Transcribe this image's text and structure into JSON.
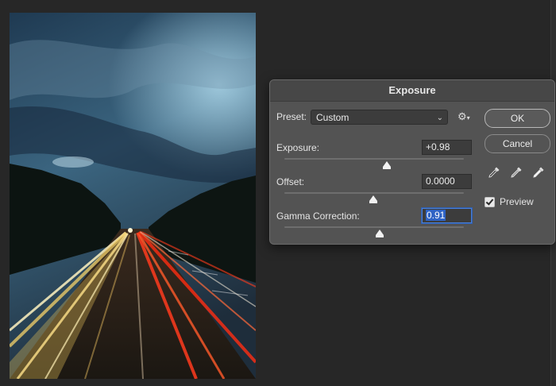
{
  "dialog": {
    "title": "Exposure",
    "preset_label": "Preset:",
    "preset_value": "Custom",
    "exposure_label": "Exposure:",
    "exposure_value": "+0.98",
    "offset_label": "Offset:",
    "offset_value": "0.0000",
    "gamma_label": "Gamma Correction:",
    "gamma_value": "0.91",
    "ok_label": "OK",
    "cancel_label": "Cancel",
    "preview_label": "Preview",
    "preview_checked": true
  },
  "icons": {
    "preset_menu": "chevron-down-icon",
    "settings": "gear-icon",
    "droppers": [
      "black-point-eyedropper-icon",
      "gray-point-eyedropper-icon",
      "white-point-eyedropper-icon"
    ]
  },
  "colors": {
    "dialog_bg": "#535353",
    "selection": "#2f63c4"
  }
}
